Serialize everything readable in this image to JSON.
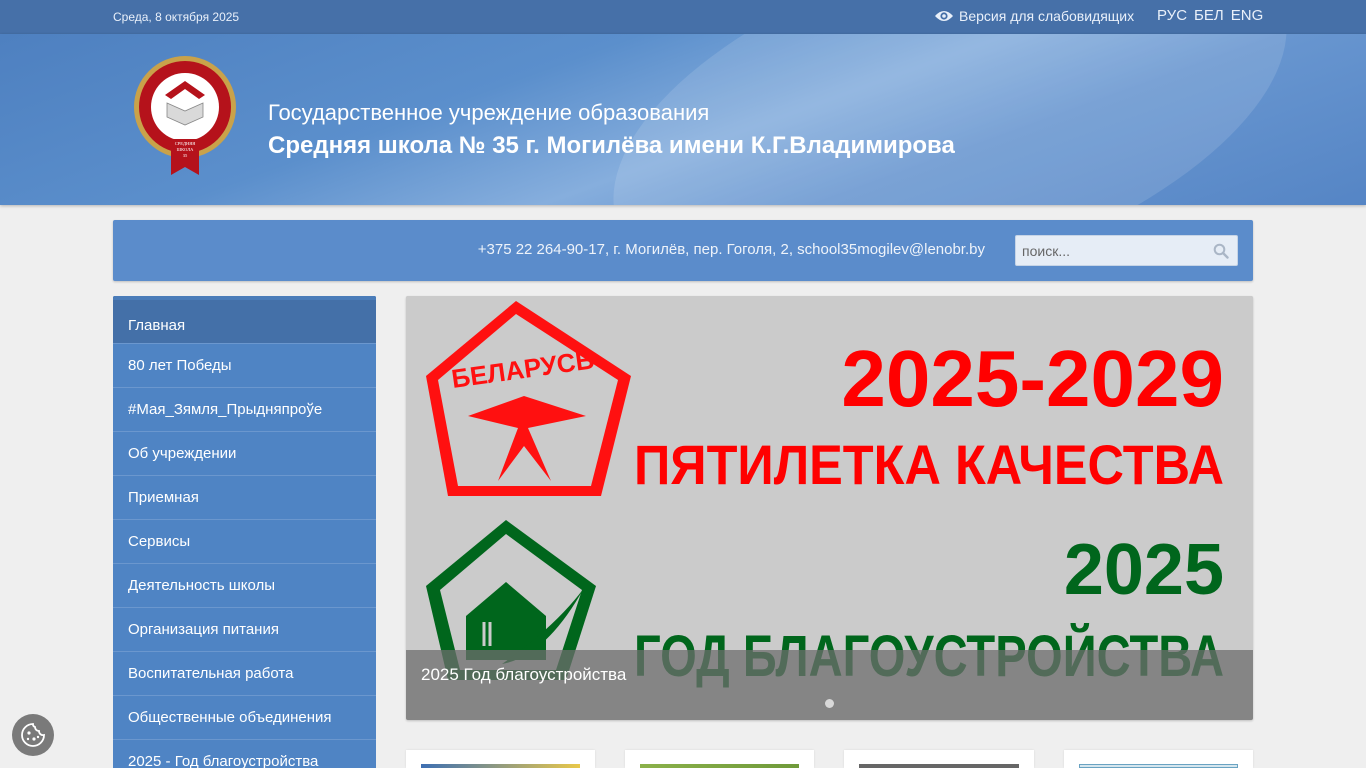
{
  "topbar": {
    "date": "Среда, 8 октября 2025",
    "vision_label": "Версия для слабовидящих",
    "languages": [
      "РУС",
      "БЕЛ",
      "ENG"
    ]
  },
  "header": {
    "org_line1": "Государственное учреждение образования",
    "org_line2": "Средняя школа № 35 г. Могилёва имени К.Г.Владимирова",
    "logo": {
      "year": "1981",
      "text1": "СРЕДНЯЯ",
      "text2": "ШКОЛА",
      "text3": "35"
    }
  },
  "infobar": {
    "contact": "+375 22 264-90-17, г. Могилёв, пер. Гоголя, 2, school35mogilev@lenobr.by",
    "search_placeholder": "поиск..."
  },
  "sidebar": {
    "items": [
      "Главная",
      "80 лет Победы",
      "#Мая_Зямля_Прыдняпроўе",
      "Об учреждении",
      "Приемная",
      "Сервисы",
      "Деятельность школы",
      "Организация питания",
      "Воспитательная работа",
      "Общественные объединения",
      "2025 - Год благоустройства"
    ]
  },
  "slider": {
    "caption": "2025 Год благоустройства",
    "banner": {
      "badge_top": "БЕЛАРУСЬ",
      "line1": "2025-2029",
      "line2": "ПЯТИЛЕТКА КАЧЕСТВА",
      "line3": "2025",
      "line4": "ГОД БЛАГОУСТРОЙСТВА"
    }
  },
  "colors": {
    "topbar": "#4670a8",
    "sidebar": "#4f84c4",
    "banner_red": "#ff0000",
    "banner_green": "#00661c"
  }
}
